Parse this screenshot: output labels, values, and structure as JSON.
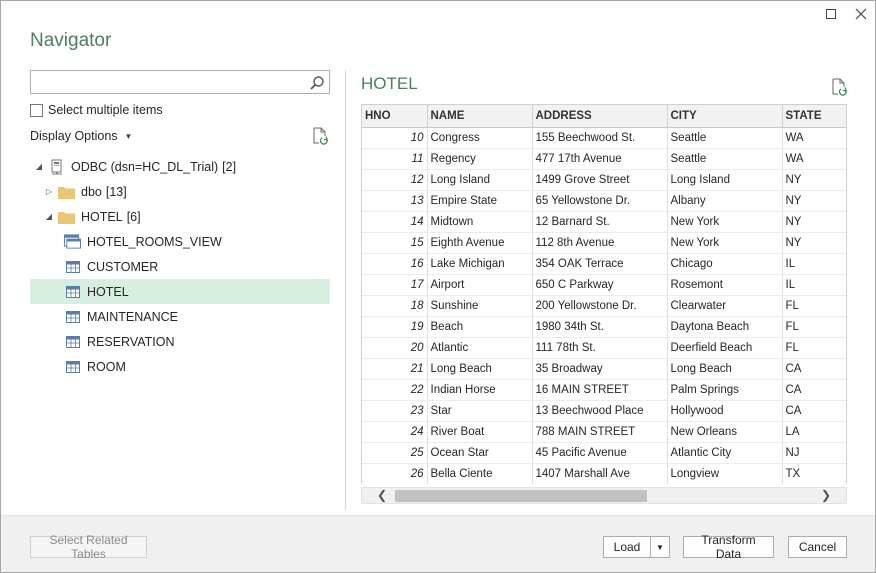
{
  "dialog": {
    "title": "Navigator"
  },
  "search": {
    "value": "",
    "placeholder": ""
  },
  "select_multiple": {
    "label": "Select multiple items",
    "checked": false
  },
  "display_options": {
    "label": "Display Options"
  },
  "tree": {
    "root": {
      "label": "ODBC (dsn=HC_DL_Trial)",
      "count": "[2]"
    },
    "dbo": {
      "label": "dbo",
      "count": "[13]"
    },
    "hotel": {
      "label": "HOTEL",
      "count": "[6]"
    },
    "items": [
      {
        "label": "HOTEL_ROOMS_VIEW",
        "icon": "view-icon"
      },
      {
        "label": "CUSTOMER",
        "icon": "table-icon"
      },
      {
        "label": "HOTEL",
        "icon": "table-icon",
        "selected": true
      },
      {
        "label": "MAINTENANCE",
        "icon": "table-icon"
      },
      {
        "label": "RESERVATION",
        "icon": "table-icon"
      },
      {
        "label": "ROOM",
        "icon": "table-icon"
      }
    ]
  },
  "preview": {
    "title": "HOTEL",
    "columns": [
      "HNO",
      "NAME",
      "ADDRESS",
      "CITY",
      "STATE"
    ],
    "rows": [
      [
        "10",
        "Congress",
        "155 Beechwood St.",
        "Seattle",
        "WA"
      ],
      [
        "11",
        "Regency",
        "477 17th Avenue",
        "Seattle",
        "WA"
      ],
      [
        "12",
        "Long Island",
        "1499 Grove Street",
        "Long Island",
        "NY"
      ],
      [
        "13",
        "Empire State",
        "65 Yellowstone Dr.",
        "Albany",
        "NY"
      ],
      [
        "14",
        "Midtown",
        "12 Barnard St.",
        "New York",
        "NY"
      ],
      [
        "15",
        "Eighth Avenue",
        "112 8th Avenue",
        "New York",
        "NY"
      ],
      [
        "16",
        "Lake Michigan",
        "354 OAK Terrace",
        "Chicago",
        "IL"
      ],
      [
        "17",
        "Airport",
        "650 C Parkway",
        "Rosemont",
        "IL"
      ],
      [
        "18",
        "Sunshine",
        "200 Yellowstone Dr.",
        "Clearwater",
        "FL"
      ],
      [
        "19",
        "Beach",
        "1980 34th St.",
        "Daytona Beach",
        "FL"
      ],
      [
        "20",
        "Atlantic",
        "111 78th St.",
        "Deerfield Beach",
        "FL"
      ],
      [
        "21",
        "Long Beach",
        "35 Broadway",
        "Long Beach",
        "CA"
      ],
      [
        "22",
        "Indian Horse",
        "16 MAIN STREET",
        "Palm Springs",
        "CA"
      ],
      [
        "23",
        "Star",
        "13 Beechwood Place",
        "Hollywood",
        "CA"
      ],
      [
        "24",
        "River Boat",
        "788 MAIN STREET",
        "New Orleans",
        "LA"
      ],
      [
        "25",
        "Ocean Star",
        "45 Pacific Avenue",
        "Atlantic City",
        "NJ"
      ],
      [
        "26",
        "Bella Ciente",
        "1407 Marshall Ave",
        "Longview",
        "TX"
      ]
    ]
  },
  "buttons": {
    "select_related": "Select Related Tables",
    "load": "Load",
    "transform": "Transform Data",
    "cancel": "Cancel"
  },
  "colors": {
    "accent": "#4d7e5c",
    "selected_bg": "#d7efe0",
    "folder": "#e8c675"
  }
}
